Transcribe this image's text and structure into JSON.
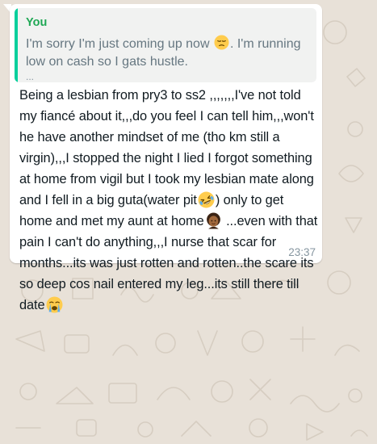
{
  "chat": {
    "quoted": {
      "author": "You",
      "text_before_emoji": "I'm sorry I'm just coming up now ",
      "emoji": "pensive-face",
      "text_after_emoji": ". I'm running low on cash so I gats hustle.",
      "more": "..."
    },
    "message": {
      "part1": "Being a lesbian from pry3 to ss2 ,,,,,,,I've not told my fiancé about it,,,do you feel I can tell him,,,won't he have another mindset of me (tho km still a virgin),,,I stopped the night I lied I forgot something at home from vigil but I took my lesbian mate along and I fell in a big guta(water pit",
      "emoji1": "rolling-on-floor-laughing",
      "part2": ") only to get home and met my aunt at home",
      "emoji2": "woman-dark-skin",
      "part3": " ...even with that pain I can't do anything,,,I nurse that scar for months...its was just rotten and rotten..the scare its so deep cos nail entered my leg...its still there till date",
      "emoji3": "loudly-crying-face",
      "time": "23:37"
    },
    "colors": {
      "wallpaper": "#e8e1d8",
      "bubble": "#ffffff",
      "quote_bg": "#f1f2f1",
      "quote_bar": "#06cf9c",
      "quote_author": "#1fa855",
      "text": "#111b21",
      "meta": "#8696a0"
    }
  }
}
